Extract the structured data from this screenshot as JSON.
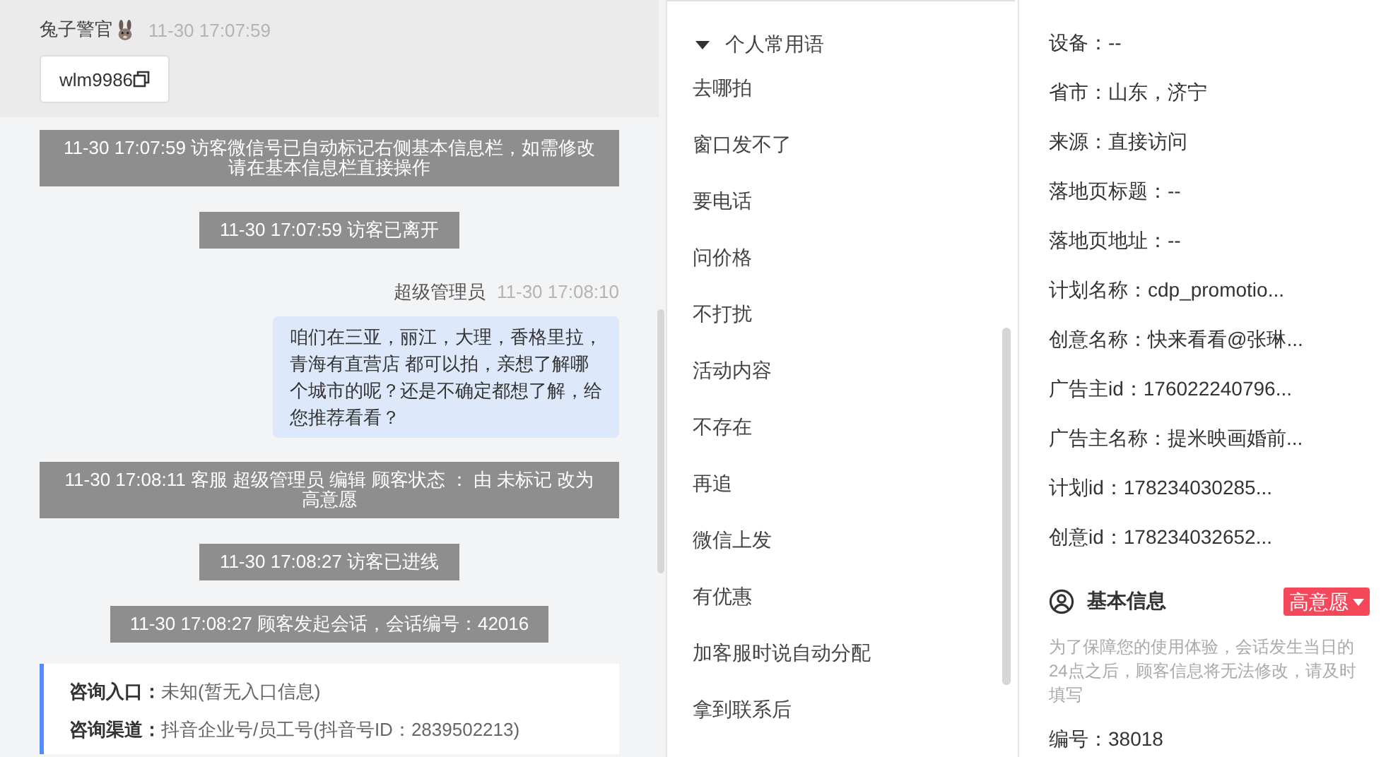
{
  "chat": {
    "visitor": {
      "name": "兔子警官",
      "time": "11-30 17:07:59",
      "wechat_chip": "wlm9986"
    },
    "messages": [
      {
        "kind": "system",
        "text": "11-30 17:07:59 访客微信号已自动标记右侧基本信息栏，如需修改请在基本信息栏直接操作"
      },
      {
        "kind": "system",
        "text": "11-30 17:07:59 访客已离开"
      },
      {
        "kind": "agent",
        "sender": "超级管理员",
        "time": "11-30 17:08:10",
        "text": "咱们在三亚，丽江，大理，香格里拉，青海有直营店 都可以拍，亲想了解哪个城市的呢？还是不确定都想了解，给您推荐看看？"
      },
      {
        "kind": "system",
        "text": "11-30 17:08:11 客服 超级管理员 编辑 顾客状态 ： 由 未标记 改为高意愿"
      },
      {
        "kind": "system",
        "text": "11-30 17:08:27 访客已进线"
      },
      {
        "kind": "system",
        "text": "11-30 17:08:27 顾客发起会话，会话编号：42016"
      },
      {
        "kind": "info",
        "rows": [
          {
            "label": "咨询入口：",
            "value": "未知(暂无入口信息)"
          },
          {
            "label": "咨询渠道：",
            "value": "抖音企业号/员工号(抖音号ID：2839502213)"
          }
        ]
      }
    ]
  },
  "phrases": {
    "group": {
      "title": "个人常用语",
      "expanded": true
    },
    "items": [
      "去哪拍",
      "窗口发不了",
      "要电话",
      "问价格",
      "不打扰",
      "活动内容",
      "不存在",
      "再追",
      "微信上发",
      "有优惠",
      "加客服时说自动分配",
      "拿到联系后"
    ]
  },
  "details": {
    "rows": [
      "设备：--",
      "省市：山东，济宁",
      "来源：直接访问",
      "落地页标题：--",
      "落地页地址：--",
      "计划名称：cdp_promotio...",
      "创意名称：快来看看@张琳...",
      "广告主id：176022240796...",
      "广告主名称：提米映画婚前...",
      "计划id：178234030285...",
      "创意id：178234032652..."
    ],
    "basic_info": {
      "title": "基本信息",
      "status_tag": "高意愿",
      "notice": "为了保障您的使用体验，会话发生当日的24点之后，顾客信息将无法修改，请及时填写",
      "id_label": "编号：",
      "id_value": "38018"
    }
  }
}
